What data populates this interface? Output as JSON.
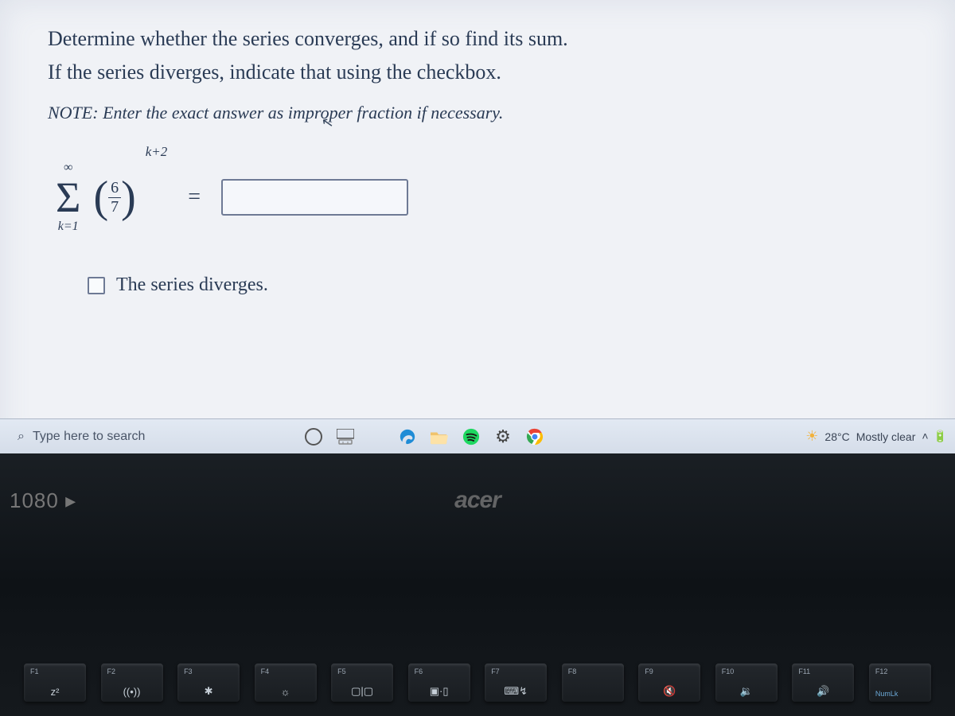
{
  "question": {
    "line1": "Determine whether the series converges, and if so find its sum.",
    "line2": "If the series diverges, indicate that using the checkbox.",
    "note_prefix": "NOTE:",
    "note_body": "Enter the exact answer as improper fraction if necessary."
  },
  "series": {
    "sigma_top": "∞",
    "sigma_bottom": "k=1",
    "frac_num": "6",
    "frac_den": "7",
    "exponent": "k+2",
    "equals": "="
  },
  "checkbox_label": "The series diverges.",
  "taskbar": {
    "search_placeholder": "Type here to search",
    "weather_temp": "28°C",
    "weather_desc": "Mostly clear",
    "systray_caret": "˄"
  },
  "bezel": {
    "badge": "1080 ▸",
    "brand": "acer"
  },
  "fn_keys": [
    {
      "f": "F1",
      "sym": "z²"
    },
    {
      "f": "F2",
      "sym": "((•))"
    },
    {
      "f": "F3",
      "sym": "✱"
    },
    {
      "f": "F4",
      "sym": "☼"
    },
    {
      "f": "F5",
      "sym": "▢|▢"
    },
    {
      "f": "F6",
      "sym": "▣·▯"
    },
    {
      "f": "F7",
      "sym": "⌨↯"
    },
    {
      "f": "F8",
      "sym": ""
    },
    {
      "f": "F9",
      "sym": "🔇"
    },
    {
      "f": "F10",
      "sym": "🔉"
    },
    {
      "f": "F11",
      "sym": "🔊"
    },
    {
      "f": "F12",
      "sym": "",
      "blue": "NumLk"
    }
  ]
}
